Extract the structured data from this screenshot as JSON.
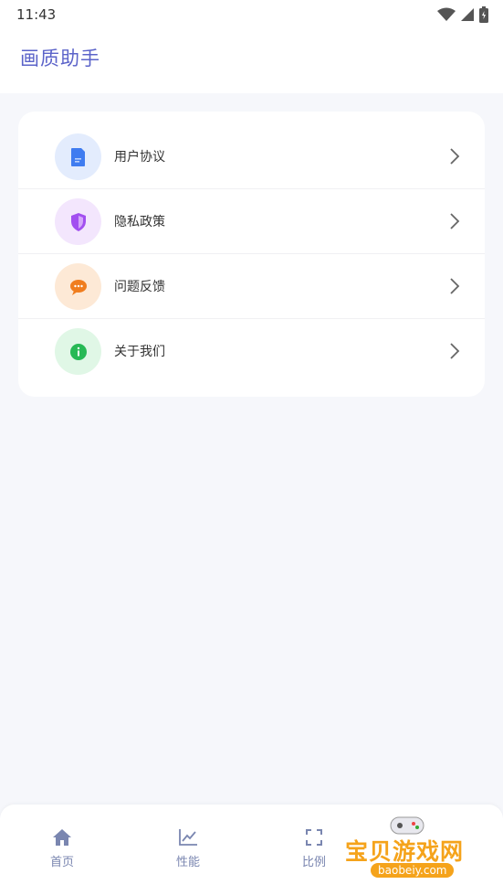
{
  "status_bar": {
    "time": "11:43"
  },
  "header": {
    "title": "画质助手"
  },
  "menu": {
    "items": [
      {
        "label": "用户协议",
        "icon": "document-icon",
        "icon_bg": "#e3ecfd",
        "icon_color": "#3f7cf0"
      },
      {
        "label": "隐私政策",
        "icon": "shield-icon",
        "icon_bg": "#f3e6fd",
        "icon_color": "#a24ff0"
      },
      {
        "label": "问题反馈",
        "icon": "chat-bubble-icon",
        "icon_bg": "#fde9d6",
        "icon_color": "#f07d1e"
      },
      {
        "label": "关于我们",
        "icon": "info-icon",
        "icon_bg": "#e0f7e6",
        "icon_color": "#27b955"
      }
    ]
  },
  "tab_bar": {
    "tabs": [
      {
        "label": "首页",
        "icon": "home-icon"
      },
      {
        "label": "性能",
        "icon": "line-chart-icon"
      },
      {
        "label": "比例",
        "icon": "fullscreen-icon"
      },
      {
        "label": "",
        "icon": ""
      }
    ]
  },
  "watermark": {
    "text": "宝贝游戏网",
    "url": "baobeiy.com"
  },
  "colors": {
    "accent": "#5b63c9",
    "tab_color": "#7a86b0",
    "background": "#f6f7fb"
  }
}
